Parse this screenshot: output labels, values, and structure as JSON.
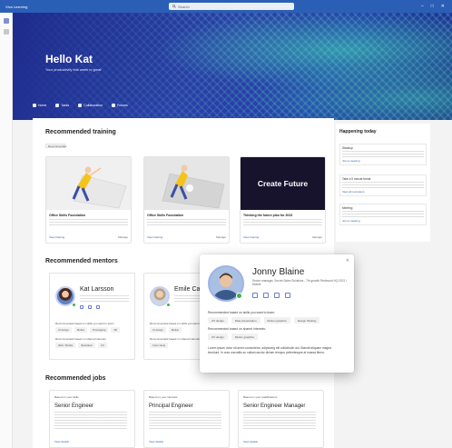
{
  "titlebar": {
    "app_name": "Viva Learning",
    "search_placeholder": "Search"
  },
  "hero": {
    "title": "Hello Kat",
    "subtitle": "Your productivity this week is great",
    "links": [
      "Home",
      "Tasks",
      "Collaboration",
      "Forums"
    ]
  },
  "training": {
    "title": "Recommended training",
    "filter": "Recommended",
    "cards": [
      {
        "title": "Office Skills Foundation",
        "link": "View training",
        "action": "Manage"
      },
      {
        "title": "Office Skills Foundation",
        "link": "View training",
        "action": "Manage"
      },
      {
        "title": "Thinking the future plan for 2023",
        "thumb_text": "Create Future",
        "link": "View training",
        "action": "Manage"
      }
    ]
  },
  "mentors": {
    "title": "Recommended mentors",
    "cards": [
      {
        "name": "Kat Larsson",
        "label1": "Recommended based on skills you want to learn",
        "chips1": [
          "UI design",
          "Motion",
          "Prototyping",
          "3D"
        ],
        "label2": "Recommended based on shared interests",
        "chips2": [
          "Web / Mobile",
          "Illustration",
          "UX"
        ]
      },
      {
        "name": "Emile Carter",
        "label1": "Recommended based on skills you want to learn",
        "chips1": [
          "UI design",
          "Motion"
        ],
        "label2": "Recommended based on shared interests",
        "chips2": [
          "Color study"
        ]
      }
    ]
  },
  "popup": {
    "name": "Jonny Blaine",
    "sub": "Senior manager, Secret Sales Solutions - 7th growth Redmond HQ 2021 / Mobile",
    "label1": "Recommended based on skills you want to learn:",
    "chips1": [
      "UX design",
      "Data presentation",
      "Motion graphics",
      "Design thinking"
    ],
    "label2": "Recommended based on shared interests:",
    "chips2": [
      "UX design",
      "Motion graphics"
    ],
    "para": "Lorem ipsum dolor sit amet consectetur, adipiscing elit sollicitudin dui. Blandit aliquam magna tincidunt. In cras convallis ac nullam auctor dictum tempus pellentesque at massa libero."
  },
  "jobs": {
    "title": "Recommended jobs",
    "cards": [
      {
        "badge": "Based on your skills",
        "title": "Senior Engineer",
        "link": "View details"
      },
      {
        "badge": "Based on your interests",
        "title": "Principal Engineer",
        "link": "View details"
      },
      {
        "badge": "Based on your qualifications",
        "title": "Senior Engineer Manager",
        "link": "View details"
      }
    ]
  },
  "happening": {
    "title": "Happening today",
    "items": [
      {
        "title": "Standup",
        "link": "Join a meeting"
      },
      {
        "title": "Take a 5 minute break",
        "link": "View all reminders"
      },
      {
        "title": "Meeting",
        "link": "Join a meeting"
      }
    ]
  },
  "colors": {
    "accent": "#2b5fb6",
    "hero": "#2a3fa6",
    "status_green": "#3fb04a"
  }
}
